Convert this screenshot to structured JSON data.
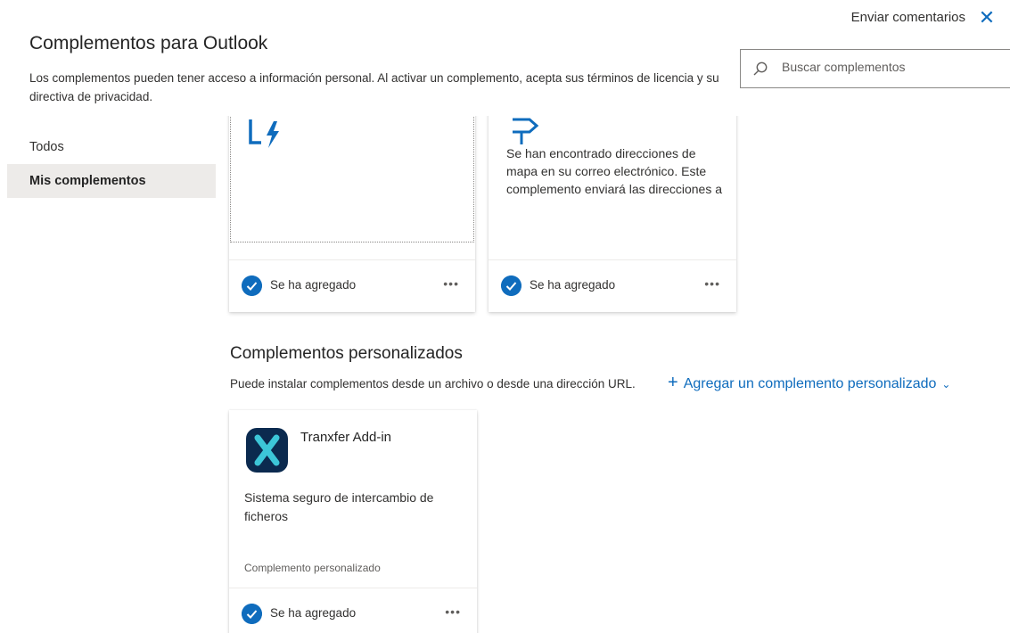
{
  "header": {
    "feedback_label": "Enviar comentarios",
    "close_glyph": "✕",
    "title": "Complementos para Outlook",
    "description": "Los complementos pueden tener acceso a información personal. Al activar un complemento, acepta sus términos de licencia y su directiva de privacidad."
  },
  "search": {
    "placeholder": "Buscar complementos",
    "value": ""
  },
  "sidebar": {
    "items": [
      {
        "label": "Todos",
        "active": false
      },
      {
        "label": "Mis complementos",
        "active": true
      }
    ]
  },
  "my_addins": {
    "cards": [
      {
        "icon": "lightning-addin-icon",
        "description": "",
        "status_label": "Se ha agregado",
        "more_glyph": "•••"
      },
      {
        "icon": "map-sign-icon",
        "description": "Se han encontrado direcciones de mapa en su correo electrónico. Este complemento enviará las direcciones a",
        "status_label": "Se ha agregado",
        "more_glyph": "•••"
      }
    ]
  },
  "custom_section": {
    "title": "Complementos personalizados",
    "description": "Puede instalar complementos desde un archivo o desde una dirección URL.",
    "add_button_label": "Agregar un complemento personalizado",
    "add_glyph": "+",
    "chevron_glyph": "⌄",
    "card": {
      "name": "Tranxfer Add-in",
      "icon": "tranxfer-x-icon",
      "description": "Sistema seguro de intercambio de ficheros",
      "tag": "Complemento personalizado",
      "status_label": "Se ha agregado",
      "more_glyph": "•••"
    }
  },
  "colors": {
    "accent": "#0f6cbd",
    "selected_nav": "#edebe9",
    "tranxfer_bg": "#0b2a4f",
    "tranxfer_x": "#3cc6d8"
  }
}
